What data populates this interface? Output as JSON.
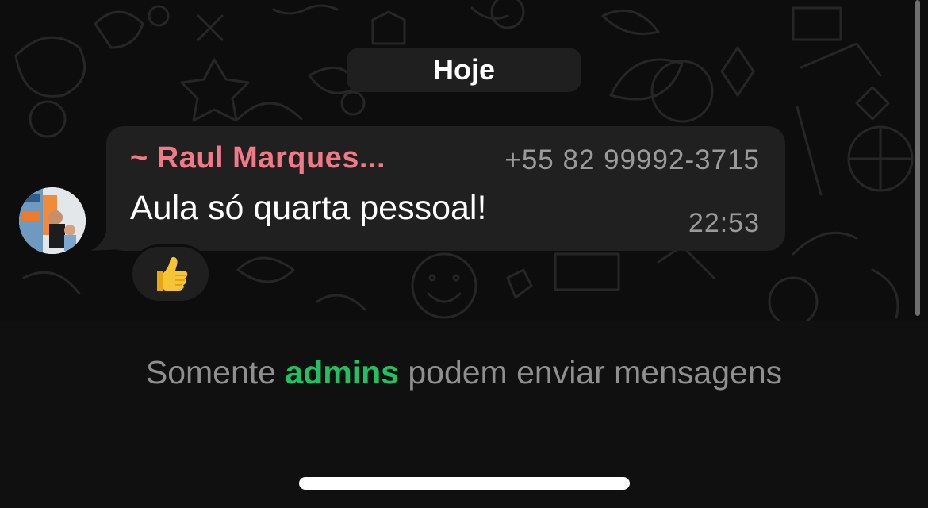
{
  "chat": {
    "date_separator": "Hoje",
    "message": {
      "sender_name": "~ Raul Marques...",
      "sender_phone": "+55 82 99992-3715",
      "text": "Aula só quarta pessoal!",
      "time": "22:53",
      "reaction": "👍",
      "avatar": "avatar-photo"
    }
  },
  "footer": {
    "notice_prefix": "Somente",
    "notice_highlight": "admins",
    "notice_suffix": "podem enviar mensagens"
  },
  "colors": {
    "sender_name": "#f27a86",
    "admins_highlight": "#21c063",
    "bubble": "#202020",
    "background": "#0d0d0d"
  }
}
